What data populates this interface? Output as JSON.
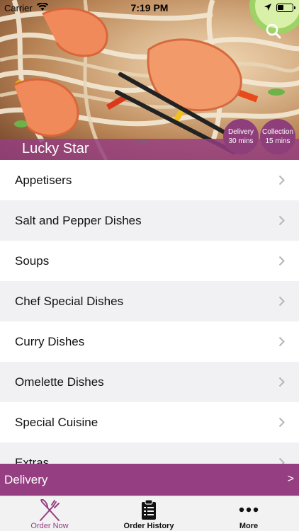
{
  "status_bar": {
    "carrier": "Carrier",
    "time": "7:19 PM"
  },
  "header": {
    "restaurant_name": "Lucky Star",
    "image_icon": "shrimp-noodles-photo",
    "badges": {
      "delivery": {
        "line1": "Delivery",
        "line2": "30 mins"
      },
      "collection": {
        "line1": "Collection",
        "line2": "15 mins"
      }
    }
  },
  "menu": {
    "items": [
      {
        "label": "Appetisers"
      },
      {
        "label": "Salt and Pepper Dishes"
      },
      {
        "label": "Soups"
      },
      {
        "label": "Chef Special Dishes"
      },
      {
        "label": "Curry Dishes"
      },
      {
        "label": "Omelette Dishes"
      },
      {
        "label": "Special Cuisine"
      },
      {
        "label": "Extras"
      }
    ]
  },
  "delivery_bar": {
    "label": "Delivery",
    "arrow": ">"
  },
  "tab_bar": {
    "tabs": [
      {
        "label": "Order Now",
        "icon": "fork-knife-icon",
        "active": true
      },
      {
        "label": "Order History",
        "icon": "clipboard-icon",
        "active": false
      },
      {
        "label": "More",
        "icon": "more-dots-icon",
        "active": false
      }
    ]
  },
  "colors": {
    "accent": "#963e82",
    "badge": "#8e3f7b",
    "list_alt_row": "#f1f1f4",
    "tab_bar_bg": "#f2f2f2"
  }
}
